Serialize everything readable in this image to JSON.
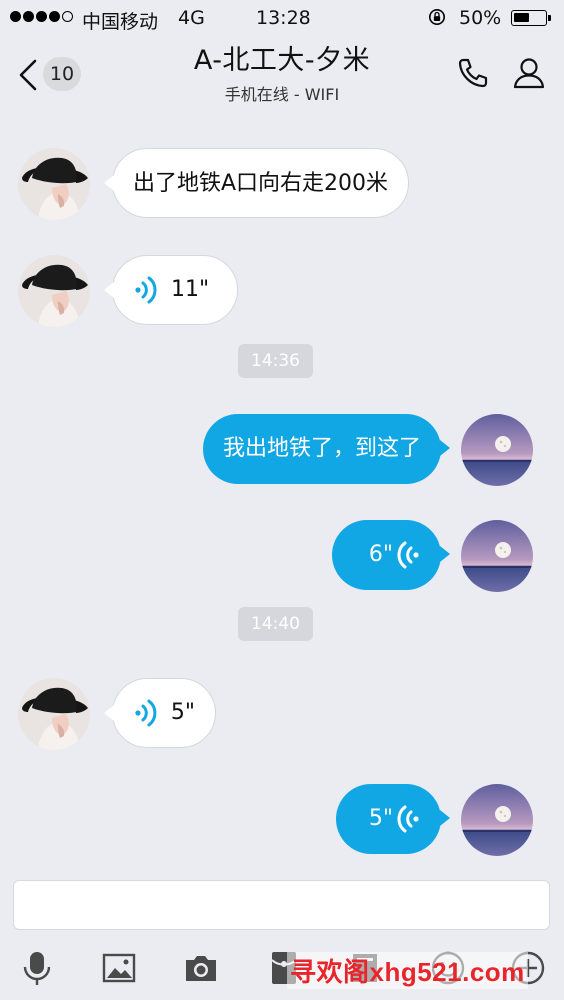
{
  "status_bar": {
    "carrier": "中国移动",
    "network": "4G",
    "time": "13:28",
    "battery_percent": "50%",
    "battery_level": 0.5,
    "signal_bars_filled": 4,
    "signal_bars_total": 5
  },
  "nav": {
    "unread_count": "10",
    "title": "A-北工大-夕米",
    "subtitle": "手机在线 - WIFI"
  },
  "messages": [
    {
      "side": "in",
      "type": "text",
      "text": "出了地铁A口向右走200米"
    },
    {
      "side": "in",
      "type": "voice",
      "duration": "11\""
    },
    {
      "type": "time",
      "text": "14:36"
    },
    {
      "side": "out",
      "type": "text",
      "text": "我出地铁了，到这了"
    },
    {
      "side": "out",
      "type": "voice",
      "duration": "6\""
    },
    {
      "type": "time",
      "text": "14:40"
    },
    {
      "side": "in",
      "type": "voice",
      "duration": "5\""
    },
    {
      "side": "out",
      "type": "voice",
      "duration": "5\""
    }
  ],
  "input": {
    "placeholder": ""
  },
  "toolbar": {
    "icons": [
      "microphone-icon",
      "image-icon",
      "camera-icon",
      "red-packet-icon",
      "keyboard-icon",
      "emoji-icon",
      "plus-icon"
    ]
  },
  "watermark": "寻欢阁xhg521.com",
  "colors": {
    "background": "#ebecf1",
    "outgoing_bubble": "#11a7e4",
    "incoming_bubble": "#ffffff",
    "voice_wave": "#11a7e4",
    "timestamp_bg": "#d6d7dc",
    "watermark": "#e8252a"
  }
}
